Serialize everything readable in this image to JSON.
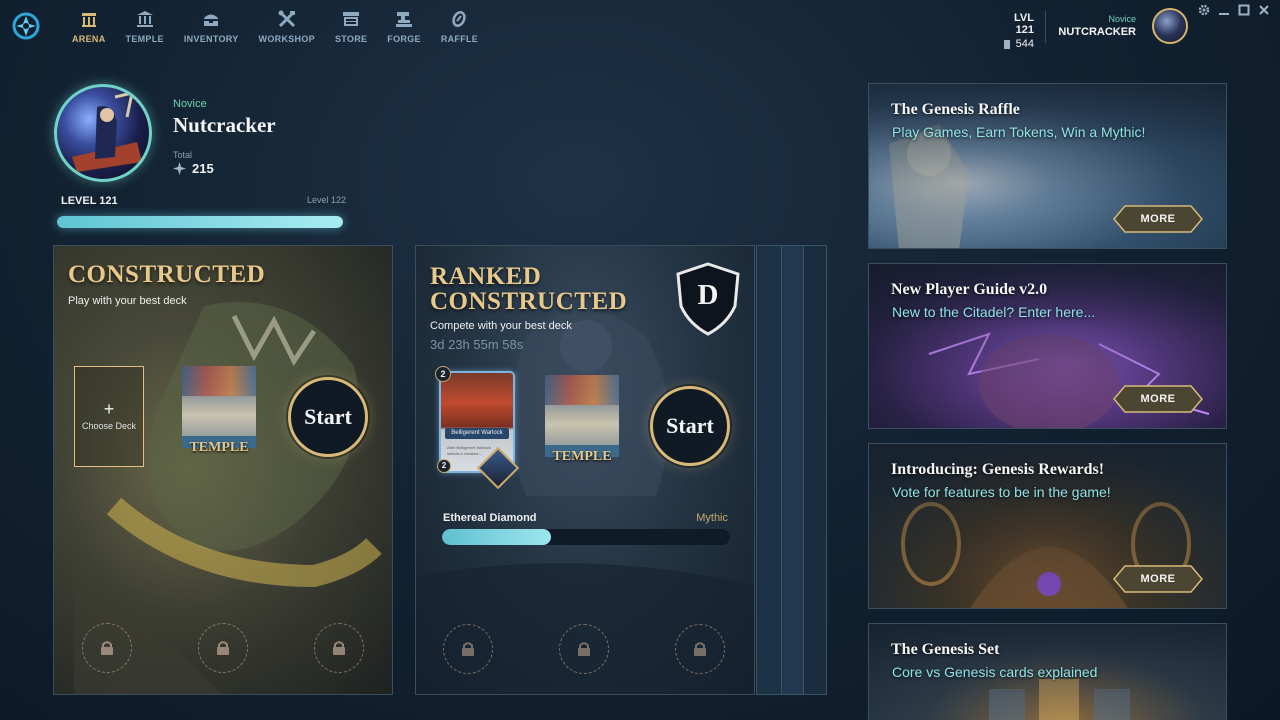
{
  "nav": {
    "items": [
      {
        "label": "ARENA",
        "icon": "arena-icon",
        "active": true
      },
      {
        "label": "TEMPLE",
        "icon": "temple-icon",
        "active": false
      },
      {
        "label": "INVENTORY",
        "icon": "inventory-icon",
        "active": false
      },
      {
        "label": "WORKSHOP",
        "icon": "workshop-icon",
        "active": false
      },
      {
        "label": "STORE",
        "icon": "store-icon",
        "active": false
      },
      {
        "label": "FORGE",
        "icon": "forge-icon",
        "active": false
      },
      {
        "label": "RAFFLE",
        "icon": "raffle-icon",
        "active": false
      }
    ]
  },
  "header": {
    "level": "LVL 121",
    "tokens": "544",
    "rank": "Novice",
    "username": "NUTCRACKER"
  },
  "profile": {
    "rank": "Novice",
    "name": "Nutcracker",
    "total_label": "Total",
    "total_value": "215",
    "level_label": "LEVEL 121",
    "next_level_label": "Level 122",
    "xp_progress": 1.0
  },
  "constructed": {
    "title": "CONSTRUCTED",
    "subtitle": "Play with your best deck",
    "choose_plus": "+",
    "choose_label": "Choose Deck",
    "deck_name": "TEMPLE",
    "start_label": "Start"
  },
  "ranked": {
    "title_line1": "RANKED",
    "title_line2": "CONSTRUCTED",
    "rank_letter": "D",
    "subtitle": "Compete with your best deck",
    "timer": "3d 23h 55m 58s",
    "hero_card": {
      "cost": "2",
      "name": "Belligerent Warlock",
      "level": "2",
      "text": "After Belligerent Warlock selects a creature..."
    },
    "deck_name": "TEMPLE",
    "start_label": "Start",
    "current_rank": "Ethereal Diamond",
    "next_rank": "Mythic",
    "rank_progress": 0.38
  },
  "news": [
    {
      "title": "The Genesis Raffle",
      "subtitle": "Play Games, Earn Tokens, Win a Mythic!",
      "button": "MORE"
    },
    {
      "title": "New Player Guide v2.0",
      "subtitle": "New to the Citadel? Enter here...",
      "button": "MORE"
    },
    {
      "title": "Introducing: Genesis Rewards!",
      "subtitle": "Vote for features to be in the game!",
      "button": "MORE"
    },
    {
      "title": "The Genesis Set",
      "subtitle": "Core vs Genesis cards explained",
      "button": "MORE"
    }
  ],
  "colors": {
    "accent_gold": "#d8b978",
    "accent_teal": "#6fd3c9",
    "rank_green": "#6fd3b5",
    "subtitle_cyan": "#8ee3e8"
  }
}
